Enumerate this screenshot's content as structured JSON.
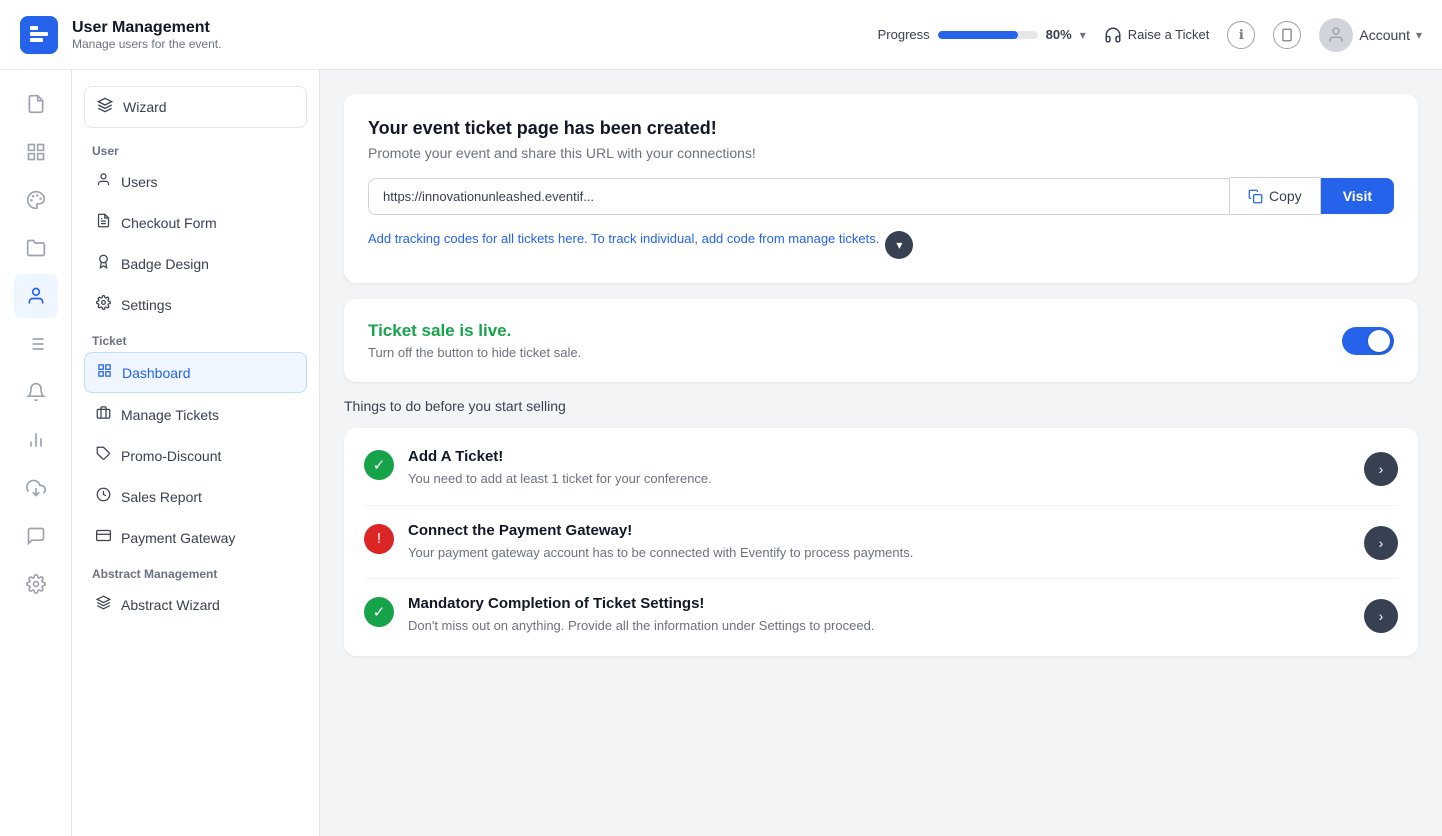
{
  "header": {
    "logo_letter": "≡",
    "title": "User Management",
    "subtitle": "Manage users for the event.",
    "progress_label": "Progress",
    "progress_percent": 80,
    "progress_percent_label": "80%",
    "raise_ticket_label": "Raise a Ticket",
    "account_label": "Account"
  },
  "icon_sidebar": {
    "items": [
      {
        "name": "document-icon",
        "icon": "🗋",
        "active": false
      },
      {
        "name": "grid-icon",
        "icon": "⊞",
        "active": false
      },
      {
        "name": "palette-icon",
        "icon": "🎨",
        "active": false
      },
      {
        "name": "folder-icon",
        "icon": "📁",
        "active": false
      },
      {
        "name": "user-icon",
        "icon": "👤",
        "active": true
      },
      {
        "name": "list-icon",
        "icon": "☰",
        "active": false
      },
      {
        "name": "bell-icon",
        "icon": "🔔",
        "active": false
      },
      {
        "name": "chart-icon",
        "icon": "📊",
        "active": false
      },
      {
        "name": "trophy-icon",
        "icon": "🏆",
        "active": false
      },
      {
        "name": "chat-icon",
        "icon": "💬",
        "active": false
      },
      {
        "name": "settings-icon",
        "icon": "⚙",
        "active": false
      }
    ]
  },
  "nav_sidebar": {
    "wizard_label": "Wizard",
    "section_user": "User",
    "section_ticket": "Ticket",
    "section_abstract": "Abstract Management",
    "user_items": [
      {
        "name": "users",
        "label": "Users",
        "icon": "👤"
      },
      {
        "name": "checkout-form",
        "label": "Checkout Form",
        "icon": "📋"
      },
      {
        "name": "badge-design",
        "label": "Badge Design",
        "icon": "🏅"
      },
      {
        "name": "settings",
        "label": "Settings",
        "icon": "⚙"
      }
    ],
    "ticket_items": [
      {
        "name": "dashboard",
        "label": "Dashboard",
        "icon": "▦",
        "active": true
      },
      {
        "name": "manage-tickets",
        "label": "Manage Tickets",
        "icon": "□"
      },
      {
        "name": "promo-discount",
        "label": "Promo-Discount",
        "icon": "🏷"
      },
      {
        "name": "sales-report",
        "label": "Sales Report",
        "icon": "◷"
      },
      {
        "name": "payment-gateway",
        "label": "Payment Gateway",
        "icon": "💳"
      }
    ],
    "abstract_items": [
      {
        "name": "abstract-wizard",
        "label": "Abstract Wizard",
        "icon": "❖"
      }
    ]
  },
  "content": {
    "event_created_title": "Your event ticket page has been created!",
    "event_created_sub": "Promote your event and share this URL with your connections!",
    "url_value": "https://innovationunleashed.eventif...",
    "copy_label": "Copy",
    "visit_label": "Visit",
    "tracking_text": "Add tracking codes for all tickets here. To track individual, add code from manage tickets.",
    "ticket_live_title": "Ticket sale is live.",
    "ticket_live_sub": "Turn off the button to hide ticket sale.",
    "things_to_do_label": "Things to do before you start selling",
    "tasks": [
      {
        "status": "success",
        "title": "Add A Ticket!",
        "desc": "You need to add at least 1 ticket for your conference."
      },
      {
        "status": "error",
        "title": "Connect the Payment Gateway!",
        "desc": "Your payment gateway account has to be connected with Eventify to process payments."
      },
      {
        "status": "success",
        "title": "Mandatory Completion of Ticket Settings!",
        "desc": "Don't miss out on anything. Provide all the information under Settings to proceed."
      }
    ]
  }
}
